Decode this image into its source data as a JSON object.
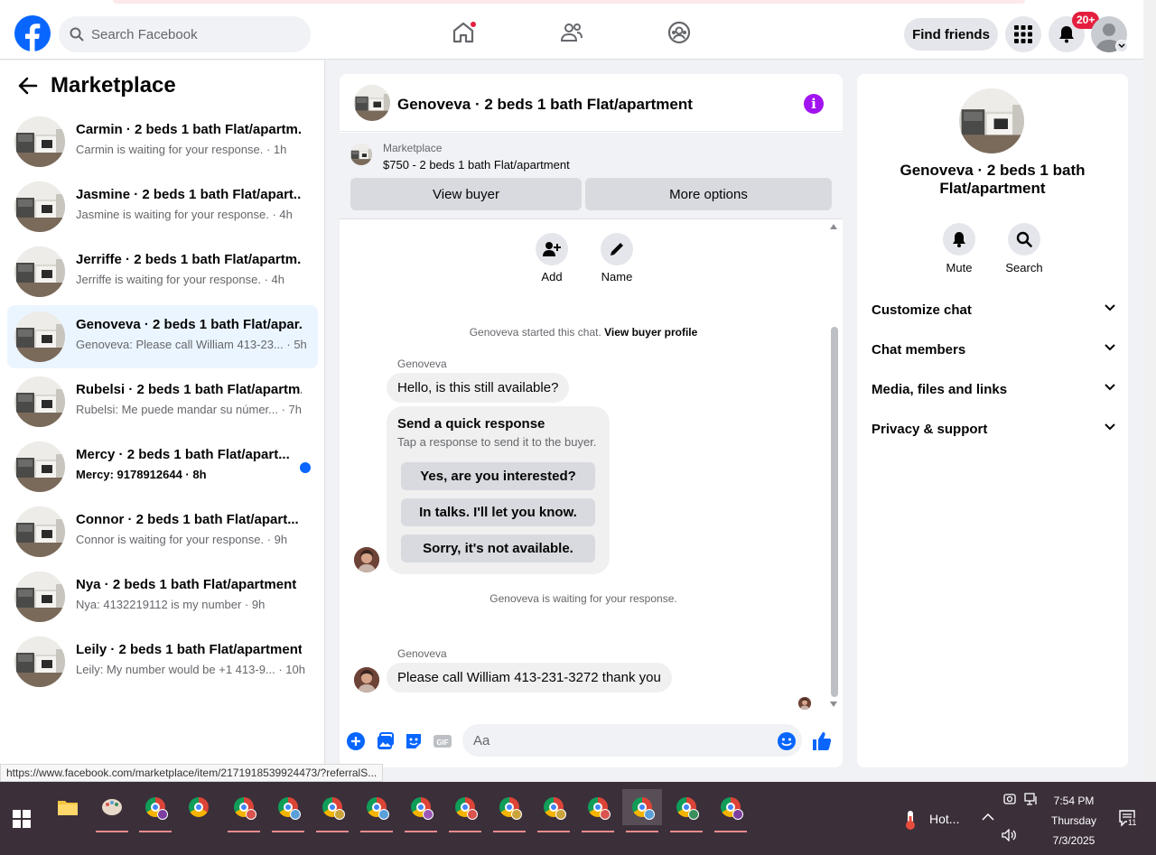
{
  "nav": {
    "search_placeholder": "Search Facebook",
    "find_friends": "Find friends",
    "notif_badge": "20+"
  },
  "sidebar": {
    "title": "Marketplace",
    "items": [
      {
        "title": "Carmin · 2 beds 1 bath Flat/apartm...",
        "sub": "Carmin is waiting for your response. · 1h",
        "unread": false,
        "active": false
      },
      {
        "title": "Jasmine · 2 beds 1 bath Flat/apart...",
        "sub": "Jasmine is waiting for your response. · 4h",
        "unread": false,
        "active": false
      },
      {
        "title": "Jerriffe · 2 beds 1 bath Flat/apartm...",
        "sub": "Jerriffe is waiting for your response. · 4h",
        "unread": false,
        "active": false
      },
      {
        "title": "Genoveva · 2 beds 1 bath Flat/apar...",
        "sub": "Genoveva: Please call William 413-23... · 5h",
        "unread": false,
        "active": true
      },
      {
        "title": "Rubelsi · 2 beds 1 bath Flat/apartm...",
        "sub": "Rubelsi: Me puede mandar su númer... · 7h",
        "unread": false,
        "active": false
      },
      {
        "title": "Mercy · 2 beds 1 bath Flat/apart...",
        "sub": "Mercy: 9178912644 · 8h",
        "unread": true,
        "active": false
      },
      {
        "title": "Connor · 2 beds 1 bath Flat/apart...",
        "sub": "Connor is waiting for your response. · 9h",
        "unread": false,
        "active": false
      },
      {
        "title": "Nya · 2 beds 1 bath Flat/apartment",
        "sub": "Nya: 4132219112 is my number · 9h",
        "unread": false,
        "active": false
      },
      {
        "title": "Leily · 2 beds 1 bath Flat/apartment",
        "sub": "Leily: My number would be +1 413-9... · 10h",
        "unread": false,
        "active": false
      }
    ]
  },
  "chat": {
    "title": "Genoveva · 2 beds 1 bath Flat/apartment",
    "listing_source": "Marketplace",
    "listing_price": "$750 - 2 beds 1 bath Flat/apartment",
    "view_buyer": "View buyer",
    "more_options": "More options",
    "add_label": "Add",
    "name_label": "Name",
    "started_text": "Genoveva started this chat.",
    "view_profile": "View buyer profile",
    "sender": "Genoveva",
    "msg1": "Hello, is this still available?",
    "quick_title": "Send a quick response",
    "quick_sub": "Tap a response to send it to the buyer.",
    "quick_replies": [
      "Yes, are you interested?",
      "In talks. I'll let you know.",
      "Sorry, it's not available."
    ],
    "waiting": "Genoveva is waiting for your response.",
    "msg2": "Please call William 413-231-3272 thank you",
    "input_placeholder": "Aa"
  },
  "details": {
    "title": "Genoveva · 2 beds 1 bath Flat/apartment",
    "mute": "Mute",
    "search": "Search",
    "sections": [
      "Customize chat",
      "Chat members",
      "Media, files and links",
      "Privacy & support"
    ]
  },
  "status_url": "https://www.facebook.com/marketplace/item/2171918539924473/?referralS...",
  "taskbar": {
    "weather": "Hot...",
    "time": "7:54 PM",
    "day": "Thursday",
    "date": "7/3/2025",
    "notif_count": "11"
  },
  "colors": {
    "brand": "#0866ff",
    "accent": "#a113f0",
    "badge": "#e41e3f"
  }
}
